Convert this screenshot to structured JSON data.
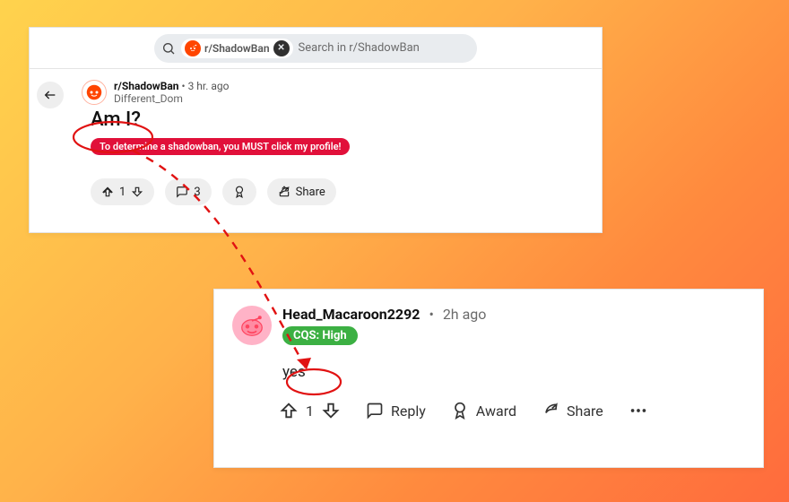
{
  "search": {
    "chip_label": "r/ShadowBan",
    "placeholder": "Search in r/ShadowBan"
  },
  "post": {
    "subreddit": "r/ShadowBan",
    "age_separator": "•",
    "age": "3 hr. ago",
    "author": "Different_Dom",
    "title": "Am I?",
    "flair": "To determine a shadowban, you MUST click my profile!",
    "actions": {
      "score": "1",
      "comments": "3",
      "share": "Share"
    }
  },
  "comment": {
    "username": "Head_Macaroon2292",
    "age_separator": "•",
    "age": "2h ago",
    "flair": "CQS: High",
    "body": "yes",
    "actions": {
      "score": "1",
      "reply": "Reply",
      "award": "Award",
      "share": "Share"
    }
  },
  "colors": {
    "reddit_orange": "#ff4500",
    "flair_red": "#e1103a",
    "flair_green": "#3cb043",
    "annotation_red": "#e11212"
  }
}
